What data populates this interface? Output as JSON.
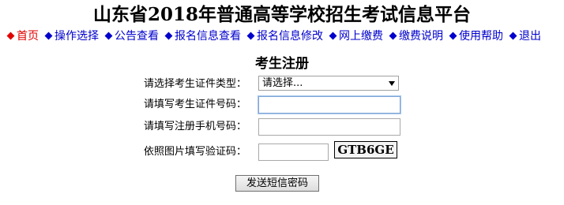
{
  "header": {
    "title": "山东省2018年普通高等学校招生考试信息平台"
  },
  "nav": {
    "items": [
      {
        "label": "首页",
        "active": true
      },
      {
        "label": "操作选择"
      },
      {
        "label": "公告查看"
      },
      {
        "label": "报名信息查看"
      },
      {
        "label": "报名信息修改"
      },
      {
        "label": "网上缴费"
      },
      {
        "label": "缴费说明"
      },
      {
        "label": "使用帮助"
      },
      {
        "label": "退出"
      }
    ]
  },
  "form": {
    "title": "考生注册",
    "id_type": {
      "label": "请选择考生证件类型：",
      "selected": "请选择..."
    },
    "id_number": {
      "label": "请填写考生证件号码："
    },
    "phone": {
      "label": "请填写注册手机号码："
    },
    "captcha": {
      "label": "依照图片填写验证码：",
      "image_text": "GTB6GE"
    },
    "submit_label": "发送短信密码"
  },
  "colors": {
    "nav_link": "#0000cc",
    "nav_active": "#e00000"
  }
}
